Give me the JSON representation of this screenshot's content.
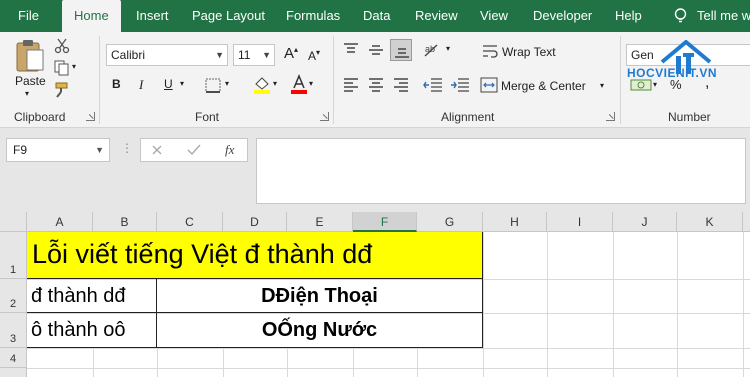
{
  "tabs": [
    {
      "label": "File"
    },
    {
      "label": "Home",
      "active": true
    },
    {
      "label": "Insert"
    },
    {
      "label": "Page Layout"
    },
    {
      "label": "Formulas"
    },
    {
      "label": "Data"
    },
    {
      "label": "Review"
    },
    {
      "label": "View"
    },
    {
      "label": "Developer"
    },
    {
      "label": "Help"
    }
  ],
  "tell_me": "Tell me wh",
  "colors": {
    "brand": "#217346",
    "title_fill": "#ffff00",
    "fill_swatch": "#ffff00",
    "font_swatch": "#ff0000"
  },
  "ribbon": {
    "clipboard": {
      "paste_label": "Paste",
      "group_label": "Clipboard"
    },
    "font": {
      "font_name": "Calibri",
      "font_size": "11",
      "bold": "B",
      "italic": "I",
      "underline": "U",
      "grow": "A",
      "shrink": "A",
      "group_label": "Font"
    },
    "alignment": {
      "wrap_text": "Wrap Text",
      "merge_center": "Merge & Center",
      "group_label": "Alignment"
    },
    "number": {
      "format": "Gen",
      "percent": "%",
      "comma": ",",
      "group_label": "Number"
    }
  },
  "watermark": {
    "text": "HOCVIENIT.VN"
  },
  "formula_bar": {
    "name_box": "F9",
    "fx": "fx",
    "formula": ""
  },
  "columns": [
    "A",
    "B",
    "C",
    "D",
    "E",
    "F",
    "G",
    "H",
    "I",
    "J",
    "K"
  ],
  "selected_column": "F",
  "rows": [
    "1",
    "2",
    "3",
    "4"
  ],
  "cells": {
    "title": "Lỗi viết tiếng Việt đ thành dđ",
    "a2": "đ thành dđ",
    "a3": "ô thành oô",
    "result2": "DĐiện Thoại",
    "result3": "OỐng Nước"
  }
}
